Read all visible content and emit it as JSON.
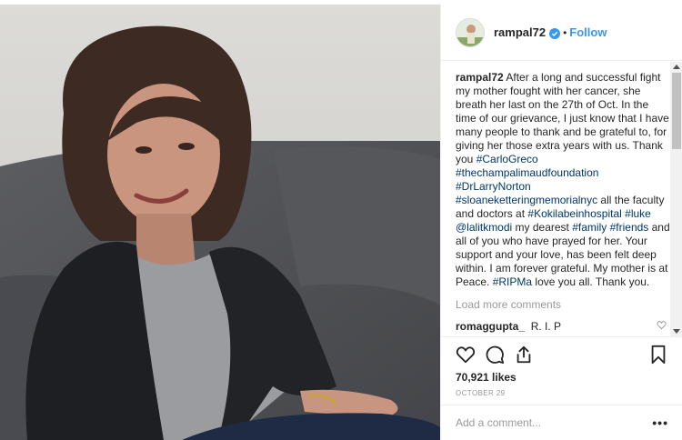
{
  "post": {
    "username": "rampal72",
    "separator": "•",
    "follow_label": "Follow",
    "caption_username": "rampal72",
    "caption_parts": [
      {
        "text": " After a long and successful fight my mother fought with her cancer, she breath her last on the 27th of Oct. In the time of our grievance, I just know that I have many people to thank and be grateful to, for giving her those extra years with us. Thank you ",
        "tag": false
      },
      {
        "text": "#CarloGreco",
        "tag": true
      },
      {
        "text": " ",
        "tag": false
      },
      {
        "text": "#thechampalimaudfoundation",
        "tag": true
      },
      {
        "text": " ",
        "tag": false
      },
      {
        "text": "#DrLarryNorton",
        "tag": true
      },
      {
        "text": " ",
        "tag": false
      },
      {
        "text": "#sloaneketteringmemorialnyc",
        "tag": true
      },
      {
        "text": " all the faculty and doctors at ",
        "tag": false
      },
      {
        "text": "#Kokilabeinhospital",
        "tag": true
      },
      {
        "text": " ",
        "tag": false
      },
      {
        "text": "#luke",
        "tag": true
      },
      {
        "text": " ",
        "tag": false
      },
      {
        "text": "@lalitkmodi",
        "tag": true
      },
      {
        "text": " my dearest ",
        "tag": false
      },
      {
        "text": "#family",
        "tag": true
      },
      {
        "text": " ",
        "tag": false
      },
      {
        "text": "#friends",
        "tag": true
      },
      {
        "text": " and all of you who have prayed for her. Your support and your love, has been felt deep within. I am forever grateful. My mother is at Peace. ",
        "tag": false
      },
      {
        "text": "#RIPMa",
        "tag": true
      },
      {
        "text": " love you all. Thank you.",
        "tag": false
      }
    ],
    "load_more_label": "Load more comments",
    "comments": [
      {
        "username": "romaggupta_",
        "text": "R. I. P"
      }
    ],
    "likes": "70,921 likes",
    "date": "OCTOBER 29",
    "add_comment_placeholder": "Add a comment...",
    "more_options": "•••"
  },
  "icons": {
    "verified": "verified-badge-icon",
    "heart": "heart-icon",
    "comment": "comment-icon",
    "share": "share-icon",
    "save": "bookmark-icon"
  },
  "colors": {
    "accent": "#3897f0",
    "hashtag": "#003569",
    "muted": "#999999"
  }
}
